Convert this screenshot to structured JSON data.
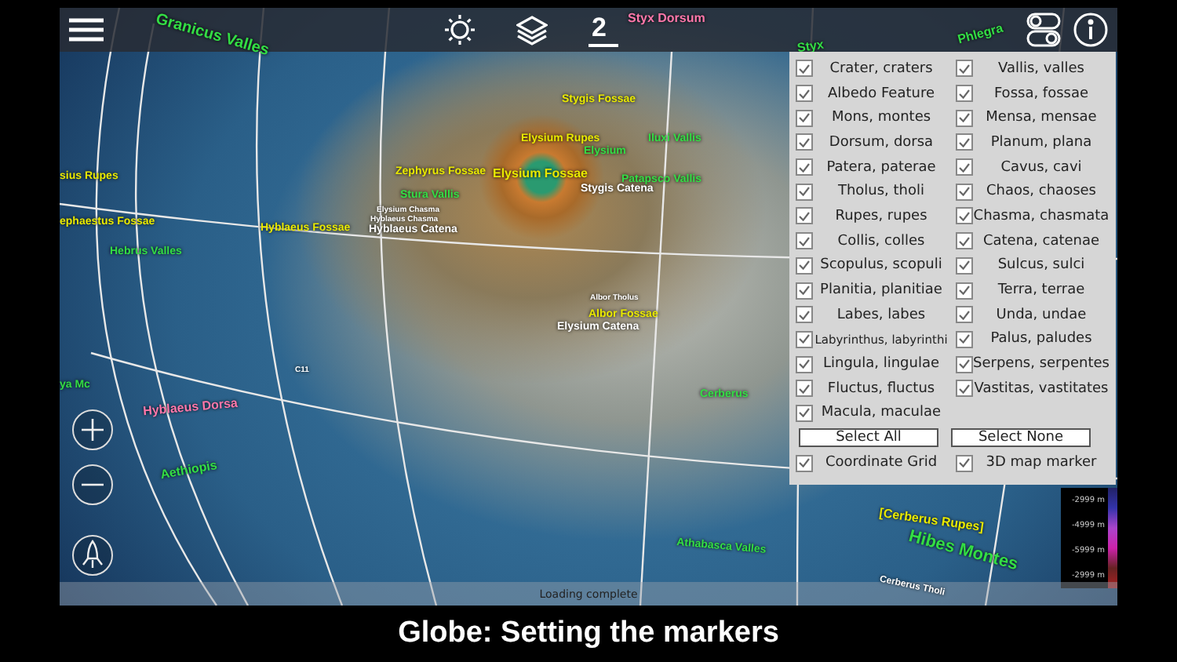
{
  "toolbar": {
    "scale_label": "2"
  },
  "map_labels": [
    {
      "text": "Granicus Valles",
      "color": "#33dd44"
    },
    {
      "text": "Styx Dorsum",
      "color": "#ff77aa"
    },
    {
      "text": "Styx",
      "color": "#33dd44"
    },
    {
      "text": "Phlegra",
      "color": "#33dd44"
    },
    {
      "text": "Stygis Fossae",
      "color": "#e8e800"
    },
    {
      "text": "Elysium Rupes",
      "color": "#e8e800"
    },
    {
      "text": "Elysium",
      "color": "#33dd44"
    },
    {
      "text": "Iluxi Vallis",
      "color": "#33dd44"
    },
    {
      "text": "Zephyrus Fossae",
      "color": "#e8e800"
    },
    {
      "text": "Elysium Fossae",
      "color": "#e8e800"
    },
    {
      "text": "Patapsco Vallis",
      "color": "#33dd44"
    },
    {
      "text": "Stygis Catena",
      "color": "#ffffff"
    },
    {
      "text": "Stura Vallis",
      "color": "#33dd44"
    },
    {
      "text": "Elysium Chasma",
      "color": "#ffffff"
    },
    {
      "text": "Hyblaeus Chasma",
      "color": "#ffffff"
    },
    {
      "text": "Hyblaeus Fossae",
      "color": "#e8e800"
    },
    {
      "text": "Hyblaeus Catena",
      "color": "#ffffff"
    },
    {
      "text": "sius Rupes",
      "color": "#e8e800"
    },
    {
      "text": "ephaestus Fossae",
      "color": "#e8e800"
    },
    {
      "text": "Hebrus Valles",
      "color": "#33dd44"
    },
    {
      "text": "Albor Tholus",
      "color": "#ffffff"
    },
    {
      "text": "Albor Fossae",
      "color": "#e8e800"
    },
    {
      "text": "Elysium Catena",
      "color": "#ffffff"
    },
    {
      "text": "C11",
      "color": "#ffffff"
    },
    {
      "text": "ya Mc",
      "color": "#33dd44"
    },
    {
      "text": "Hyblaeus Dorsa",
      "color": "#ff77aa"
    },
    {
      "text": "Cerberus",
      "color": "#33dd44"
    },
    {
      "text": "Aethiopis",
      "color": "#33dd44"
    },
    {
      "text": "Athabasca Valles",
      "color": "#33dd44"
    },
    {
      "text": "[Cerberus Rupes]",
      "color": "#e8e800"
    },
    {
      "text": "Hibes Montes",
      "color": "#33dd44"
    },
    {
      "text": "Cerberus Tholi",
      "color": "#ffffff"
    }
  ],
  "legend": [
    "-2999 m",
    "-4999 m",
    "-5999 m",
    "-2999 m"
  ],
  "status_bar": "Loading complete",
  "marker_panel": {
    "left_column": [
      {
        "label": "Crater, craters",
        "checked": true
      },
      {
        "label": "Albedo Feature",
        "checked": true
      },
      {
        "label": "Mons, montes",
        "checked": true
      },
      {
        "label": "Dorsum, dorsa",
        "checked": true
      },
      {
        "label": "Patera, paterae",
        "checked": true
      },
      {
        "label": "Tholus, tholi",
        "checked": true
      },
      {
        "label": "Rupes, rupes",
        "checked": true
      },
      {
        "label": "Collis, colles",
        "checked": true
      },
      {
        "label": "Scopulus, scopuli",
        "checked": true
      },
      {
        "label": "Planitia, planitiae",
        "checked": true
      },
      {
        "label": "Labes, labes",
        "checked": true
      },
      {
        "label": "Labyrinthus, labyrinthi",
        "checked": true
      },
      {
        "label": "Lingula, lingulae",
        "checked": true
      },
      {
        "label": "Fluctus, fluctus",
        "checked": true
      },
      {
        "label": "Macula, maculae",
        "checked": true
      }
    ],
    "right_column": [
      {
        "label": "Vallis, valles",
        "checked": true
      },
      {
        "label": "Fossa, fossae",
        "checked": true
      },
      {
        "label": "Mensa, mensae",
        "checked": true
      },
      {
        "label": "Planum, plana",
        "checked": true
      },
      {
        "label": "Cavus, cavi",
        "checked": true
      },
      {
        "label": "Chaos, chaoses",
        "checked": true
      },
      {
        "label": "Chasma, chasmata",
        "checked": true
      },
      {
        "label": "Catena, catenae",
        "checked": true
      },
      {
        "label": "Sulcus, sulci",
        "checked": true
      },
      {
        "label": "Terra, terrae",
        "checked": true
      },
      {
        "label": "Unda, undae",
        "checked": true
      },
      {
        "label": "Palus, paludes",
        "checked": true
      },
      {
        "label": "Serpens, serpentes",
        "checked": true
      },
      {
        "label": "Vastitas, vastitates",
        "checked": true
      }
    ],
    "buttons": [
      "Select All",
      "Select None"
    ],
    "options": [
      {
        "label": "Coordinate Grid",
        "checked": true
      },
      {
        "label": "3D map marker",
        "checked": true
      }
    ]
  },
  "caption": "Globe: Setting the markers"
}
